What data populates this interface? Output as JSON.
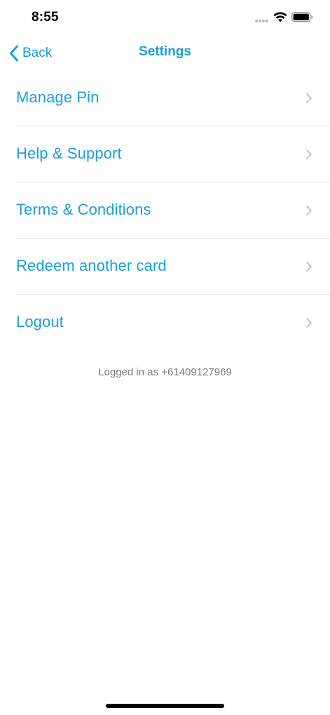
{
  "status_bar": {
    "time": "8:55"
  },
  "nav": {
    "back_label": "Back",
    "title": "Settings"
  },
  "settings": {
    "items": [
      {
        "label": "Manage Pin"
      },
      {
        "label": "Help & Support"
      },
      {
        "label": "Terms & Conditions"
      },
      {
        "label": "Redeem another card"
      },
      {
        "label": "Logout"
      }
    ]
  },
  "footer": {
    "logged_in_text": "Logged in as +61409127969"
  },
  "colors": {
    "accent": "#1a9fd8",
    "divider": "#e3e3e3",
    "chevron": "#c4c4c9",
    "muted_text": "#7a7a7a"
  },
  "icons": {
    "back": "chevron-left-icon",
    "row": "chevron-right-icon",
    "wifi": "wifi-icon",
    "battery": "battery-icon",
    "signal": "signal-icon"
  }
}
